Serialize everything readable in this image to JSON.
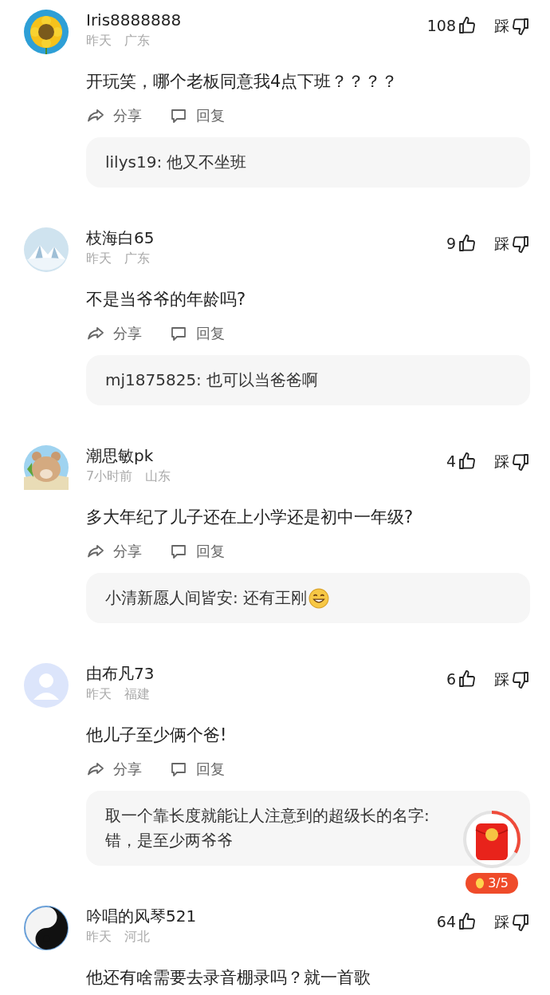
{
  "comments": [
    {
      "avatar": {
        "kind": "sunflower"
      },
      "name": "Iris8888888",
      "time": "昨天",
      "region": "广东",
      "likes": "108",
      "dislike_label": "踩",
      "text": "开玩笑，哪个老板同意我4点下班？？？？",
      "share_label": "分享",
      "reply_label": "回复",
      "replies": [
        {
          "text": "lilys19: 他又不坐班",
          "emoji": false
        }
      ]
    },
    {
      "avatar": {
        "kind": "snow"
      },
      "name": "枝海白65",
      "time": "昨天",
      "region": "广东",
      "likes": "9",
      "dislike_label": "踩",
      "text": "不是当爷爷的年龄吗?",
      "share_label": "分享",
      "reply_label": "回复",
      "replies": [
        {
          "text": "mj1875825: 也可以当爸爸啊",
          "emoji": false
        }
      ]
    },
    {
      "avatar": {
        "kind": "bear"
      },
      "name": "潮思敏pk",
      "time": "7小时前",
      "region": "山东",
      "likes": "4",
      "dislike_label": "踩",
      "text": "多大年纪了儿子还在上小学还是初中一年级?",
      "share_label": "分享",
      "reply_label": "回复",
      "replies": [
        {
          "text": "小清新愿人间皆安: 还有王刚",
          "emoji": true
        }
      ]
    },
    {
      "avatar": {
        "kind": "default"
      },
      "name": "由布凡73",
      "time": "昨天",
      "region": "福建",
      "likes": "6",
      "dislike_label": "踩",
      "text": "他儿子至少俩个爸!",
      "share_label": "分享",
      "reply_label": "回复",
      "replies": [
        {
          "text": "取一个靠长度就能让人注意到的超级长的名字: 错，是至少两爷爷",
          "emoji": false
        }
      ]
    },
    {
      "avatar": {
        "kind": "yinyang"
      },
      "name": "吟唱的风琴521",
      "time": "昨天",
      "region": "河北",
      "likes": "64",
      "dislike_label": "踩",
      "text": "他还有啥需要去录音棚录吗？就一首歌"
    }
  ],
  "red_packet": {
    "level": 0.33,
    "count": "3/5"
  }
}
